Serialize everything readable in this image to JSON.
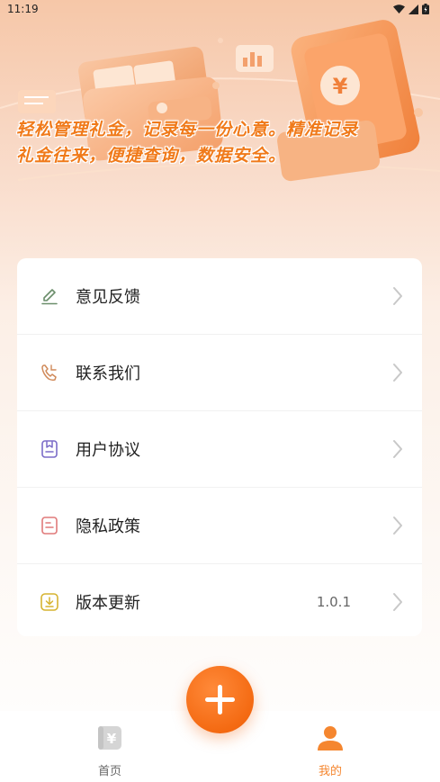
{
  "status_bar": {
    "time": "11:19",
    "icons": [
      "wifi-icon",
      "signal-icon",
      "battery-icon"
    ]
  },
  "hero": {
    "tagline_line1": "轻松管理礼金，记录每一份心意。精准记录",
    "tagline_line2": "礼金往来，便捷查询，数据安全。",
    "coin_symbol": "¥"
  },
  "menu": {
    "items": [
      {
        "label": "意见反馈",
        "icon": "pencil-icon",
        "value": ""
      },
      {
        "label": "联系我们",
        "icon": "phone-icon",
        "value": ""
      },
      {
        "label": "用户协议",
        "icon": "agreement-icon",
        "value": ""
      },
      {
        "label": "隐私政策",
        "icon": "privacy-document-icon",
        "value": ""
      },
      {
        "label": "版本更新",
        "icon": "download-icon",
        "value": "1.0.1"
      }
    ]
  },
  "tabbar": {
    "home_label": "首页",
    "home_icon_glyph": "¥",
    "mine_label": "我的"
  },
  "colors": {
    "accent": "#f5862f",
    "fab": "#f46a12",
    "hero_text": "#f07a1a"
  }
}
